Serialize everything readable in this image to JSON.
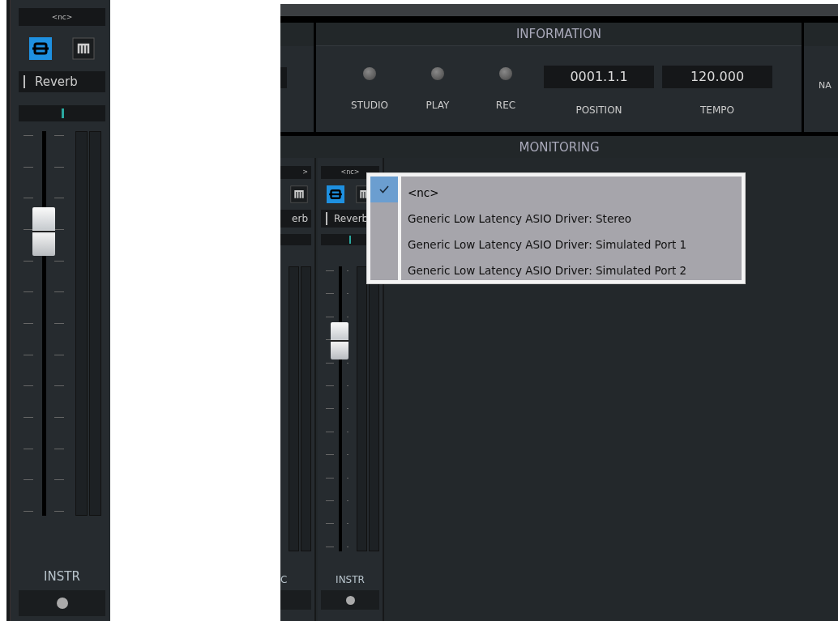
{
  "detail_strip": {
    "input": "<nc>",
    "insert": "Reverb",
    "pan": {
      "level": 0.5
    },
    "fader": {
      "level": 0.74
    },
    "name": "INSTR"
  },
  "information": {
    "title": "INFORMATION",
    "leds": [
      {
        "label": "STUDIO",
        "on": false
      },
      {
        "label": "PLAY",
        "on": false
      },
      {
        "label": "REC",
        "on": false
      }
    ],
    "fields": [
      {
        "value": "0001.1.1",
        "label": "POSITION"
      },
      {
        "value": "120.000",
        "label": "TEMPO"
      }
    ]
  },
  "side_label": "NA",
  "monitoring": {
    "title": "MONITORING",
    "strips": [
      {
        "input": ">",
        "insert": "erb",
        "name": "C",
        "partial": true
      },
      {
        "input": "<nc>",
        "insert": "Reverb",
        "pan": {
          "level": 0.5
        },
        "fader": {
          "level": 0.74
        },
        "name": "INSTR",
        "partial": false
      }
    ]
  },
  "menu": {
    "items": [
      {
        "label": "<nc>",
        "selected": true
      },
      {
        "label": "Generic Low Latency ASIO Driver: Stereo",
        "selected": false
      },
      {
        "label": "Generic Low Latency ASIO Driver: Simulated Port 1",
        "selected": false
      },
      {
        "label": "Generic Low Latency ASIO Driver: Simulated Port 2",
        "selected": false
      }
    ]
  }
}
